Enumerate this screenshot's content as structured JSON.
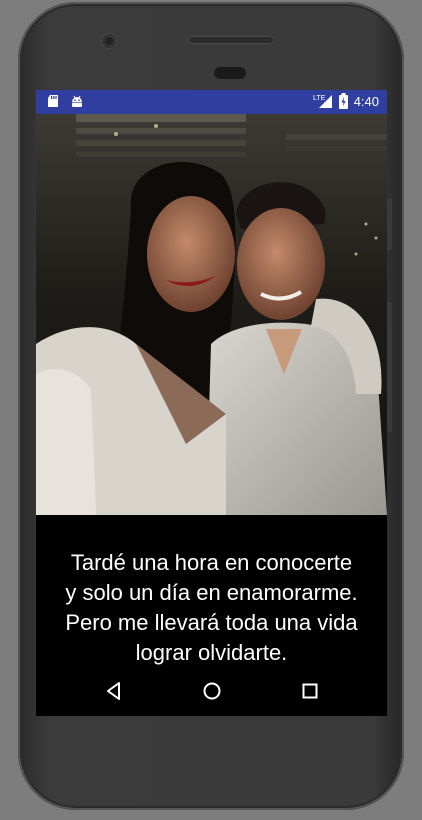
{
  "status_bar": {
    "time": "4:40",
    "left_icons": [
      "sd-card-icon",
      "android-icon"
    ],
    "right_icons": [
      "lte-signal-icon",
      "battery-icon"
    ],
    "network_label": "LTE",
    "background_color": "#303f9f"
  },
  "photo": {
    "description_icon": "couple-selfie-photo"
  },
  "quote": {
    "text": "Tardé una hora en conocerte\ny solo un día en enamorarme.\nPero me llevará toda una vida\nlograr olvidarte."
  },
  "nav_bar": {
    "back_icon": "back-triangle-icon",
    "home_icon": "home-circle-icon",
    "recents_icon": "recents-square-icon"
  },
  "colors": {
    "screen_background": "#000000",
    "device_frame": "#3a3a3a",
    "page_background": "#7d7d7d"
  }
}
